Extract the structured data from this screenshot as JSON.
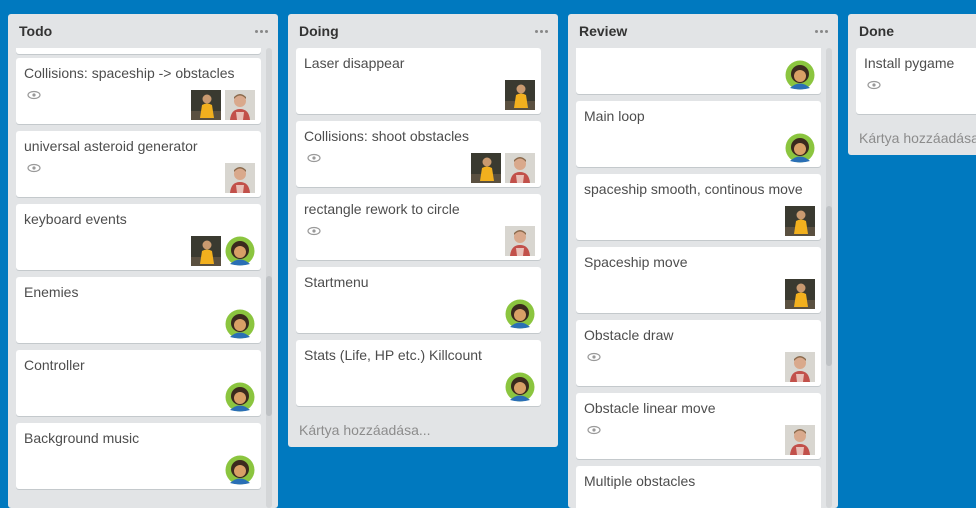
{
  "lists": [
    {
      "title": "Todo",
      "cards": [
        {
          "title": "Collisions: spaceship -> obstacles",
          "avatars": [
            "photo-dark-avatar",
            "photo-light-avatar"
          ],
          "watch": true
        },
        {
          "title": "universal asteroid generator",
          "avatars": [
            "photo-light-avatar"
          ],
          "watch": true
        },
        {
          "title": "keyboard events",
          "avatars": [
            "photo-dark-avatar",
            "cartoon-avatar"
          ],
          "watch": false
        },
        {
          "title": "Enemies",
          "avatars": [
            "cartoon-avatar"
          ],
          "watch": false
        },
        {
          "title": "Controller",
          "avatars": [
            "cartoon-avatar"
          ],
          "watch": false
        },
        {
          "title": "Background music",
          "avatars": [
            "cartoon-avatar"
          ],
          "watch": false
        }
      ]
    },
    {
      "title": "Doing",
      "cards": [
        {
          "title": "Laser disappear",
          "avatars": [
            "photo-dark-avatar"
          ],
          "watch": false
        },
        {
          "title": "Collisions: shoot obstacles",
          "avatars": [
            "photo-dark-avatar",
            "photo-light-avatar"
          ],
          "watch": true
        },
        {
          "title": "rectangle rework to circle",
          "avatars": [
            "photo-light-avatar"
          ],
          "watch": true
        },
        {
          "title": "Startmenu",
          "avatars": [
            "cartoon-avatar"
          ],
          "watch": false
        },
        {
          "title": "Stats (Life, HP etc.) Killcount",
          "avatars": [
            "cartoon-avatar"
          ],
          "watch": false
        }
      ],
      "add_card": "Kártya hozzáadása..."
    },
    {
      "title": "Review",
      "cards": [
        {
          "title": "",
          "avatars": [
            "cartoon-avatar"
          ],
          "watch": false
        },
        {
          "title": "Main loop",
          "avatars": [
            "cartoon-avatar"
          ],
          "watch": false
        },
        {
          "title": "spaceship smooth, continous move",
          "avatars": [
            "photo-dark-avatar"
          ],
          "watch": false
        },
        {
          "title": "Spaceship move",
          "avatars": [
            "photo-dark-avatar"
          ],
          "watch": false
        },
        {
          "title": "Obstacle draw",
          "avatars": [
            "photo-light-avatar"
          ],
          "watch": true
        },
        {
          "title": "Obstacle linear move",
          "avatars": [
            "photo-light-avatar"
          ],
          "watch": true
        },
        {
          "title": "Multiple obstacles",
          "avatars": [],
          "watch": false
        }
      ]
    },
    {
      "title": "Done",
      "cards": [
        {
          "title": "Install pygame",
          "avatars": [],
          "watch": true
        }
      ],
      "add_card": "Kártya hozzáadása..."
    }
  ],
  "menu_icon": "ellipsis-icon",
  "watch_icon": "eye-icon",
  "colors": {
    "board_background": "#0079bf",
    "list_background": "#e2e4e6",
    "card_background": "#ffffff",
    "card_text": "#4d4d4d",
    "add_card_text": "#8c8c8c"
  }
}
